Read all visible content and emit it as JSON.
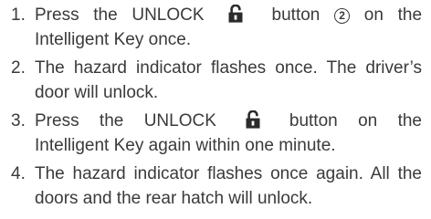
{
  "steps": [
    {
      "num": "1.",
      "pre": "Press the UNLOCK",
      "icon": "padlock-unlocked-icon",
      "mid": "button",
      "callout": "2",
      "post": "on the Intelligent Key once."
    },
    {
      "num": "2.",
      "text": "The hazard indicator flashes once. The driver’s door will unlock."
    },
    {
      "num": "3.",
      "pre": "Press the UNLOCK",
      "icon": "padlock-unlocked-icon",
      "post": "button on the Intelligent Key again within one minute."
    },
    {
      "num": "4.",
      "text": "The hazard indicator flashes once again. All the doors and the rear hatch will unlock."
    }
  ]
}
